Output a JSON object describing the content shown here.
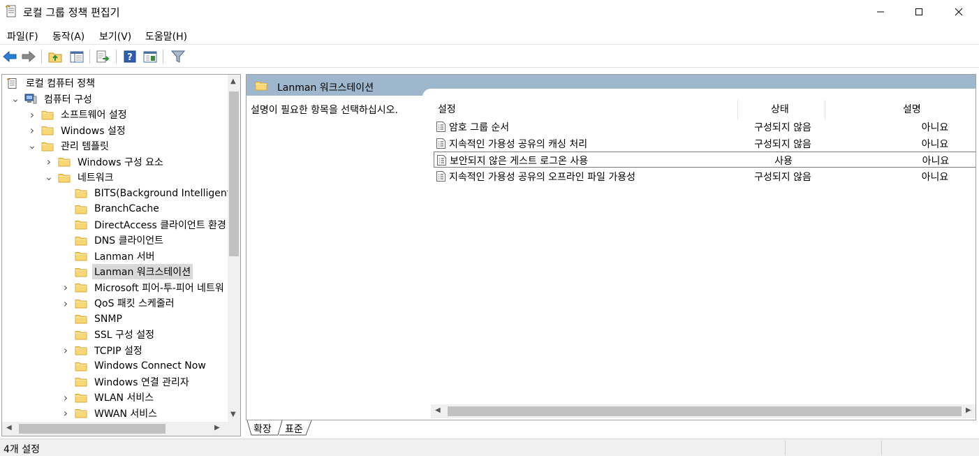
{
  "window": {
    "title": "로컬 그룹 정책 편집기",
    "controls": {
      "minimize": "—",
      "maximize": "☐",
      "close": "✕"
    }
  },
  "menu": [
    {
      "label": "파일(F)"
    },
    {
      "label": "동작(A)"
    },
    {
      "label": "보기(V)"
    },
    {
      "label": "도움말(H)"
    }
  ],
  "toolbar": {
    "icons": [
      "back-icon",
      "forward-icon",
      "up-folder-icon",
      "show-hide-tree-icon",
      "export-list-icon",
      "help-icon",
      "properties-view-icon",
      "filter-icon"
    ]
  },
  "colors": {
    "header_band": "#9fb7cd",
    "folder_fill": "#f8d775",
    "folder_edge": "#d9a93a",
    "selection": "#d9d9d9"
  },
  "tree": {
    "items": [
      {
        "label": "로컬 컴퓨터 정책",
        "icon": "policy-doc-icon"
      },
      {
        "label": "컴퓨터 구성",
        "icon": "computer-icon",
        "twisty": "expanded"
      },
      {
        "label": "소프트웨어 설정",
        "icon": "folder-icon",
        "twisty": "collapsed"
      },
      {
        "label": "Windows 설정",
        "icon": "folder-icon",
        "twisty": "collapsed"
      },
      {
        "label": "관리 템플릿",
        "icon": "folder-icon",
        "twisty": "expanded"
      },
      {
        "label": "Windows 구성 요소",
        "icon": "folder-icon",
        "twisty": "collapsed"
      },
      {
        "label": "네트워크",
        "icon": "folder-icon",
        "twisty": "expanded"
      },
      {
        "label": "BITS(Background Intelligent T",
        "icon": "folder-icon",
        "twisty": "none"
      },
      {
        "label": "BranchCache",
        "icon": "folder-icon",
        "twisty": "none"
      },
      {
        "label": "DirectAccess 클라이언트 환경",
        "icon": "folder-icon",
        "twisty": "none"
      },
      {
        "label": "DNS 클라이언트",
        "icon": "folder-icon",
        "twisty": "none"
      },
      {
        "label": "Lanman 서버",
        "icon": "folder-icon",
        "twisty": "none"
      },
      {
        "label": "Lanman 워크스테이션",
        "icon": "folder-icon",
        "twisty": "none",
        "selected": true
      },
      {
        "label": "Microsoft 피어-투-피어 네트워",
        "icon": "folder-icon",
        "twisty": "collapsed"
      },
      {
        "label": "QoS 패킷 스케줄러",
        "icon": "folder-icon",
        "twisty": "collapsed"
      },
      {
        "label": "SNMP",
        "icon": "folder-icon",
        "twisty": "none"
      },
      {
        "label": "SSL 구성 설정",
        "icon": "folder-icon",
        "twisty": "none"
      },
      {
        "label": "TCPIP 설정",
        "icon": "folder-icon",
        "twisty": "collapsed"
      },
      {
        "label": "Windows Connect Now",
        "icon": "folder-icon",
        "twisty": "none"
      },
      {
        "label": "Windows 연결 관리자",
        "icon": "folder-icon",
        "twisty": "none"
      },
      {
        "label": "WLAN 서비스",
        "icon": "folder-icon",
        "twisty": "collapsed"
      },
      {
        "label": "WWAN 서비스",
        "icon": "folder-icon",
        "twisty": "collapsed"
      }
    ]
  },
  "right": {
    "header_title": "Lanman 워크스테이션",
    "description": "설명이 필요한 항목을 선택하십시오.",
    "columns": {
      "setting": "설정",
      "state": "상태",
      "comment": "설명"
    },
    "rows": [
      {
        "name": "암호 그룹 순서",
        "state": "구성되지 않음",
        "comment": "아니요"
      },
      {
        "name": "지속적인 가용성 공유의 캐싱 처리",
        "state": "구성되지 않음",
        "comment": "아니요"
      },
      {
        "name": "보안되지 않은 게스트 로그온 사용",
        "state": "사용",
        "comment": "아니요",
        "focused": true
      },
      {
        "name": "지속적인 가용성 공유의 오프라인 파일 가용성",
        "state": "구성되지 않음",
        "comment": "아니요"
      }
    ]
  },
  "tabs": [
    {
      "label": "확장"
    },
    {
      "label": "표준"
    }
  ],
  "status": {
    "text": "4개 설정"
  }
}
